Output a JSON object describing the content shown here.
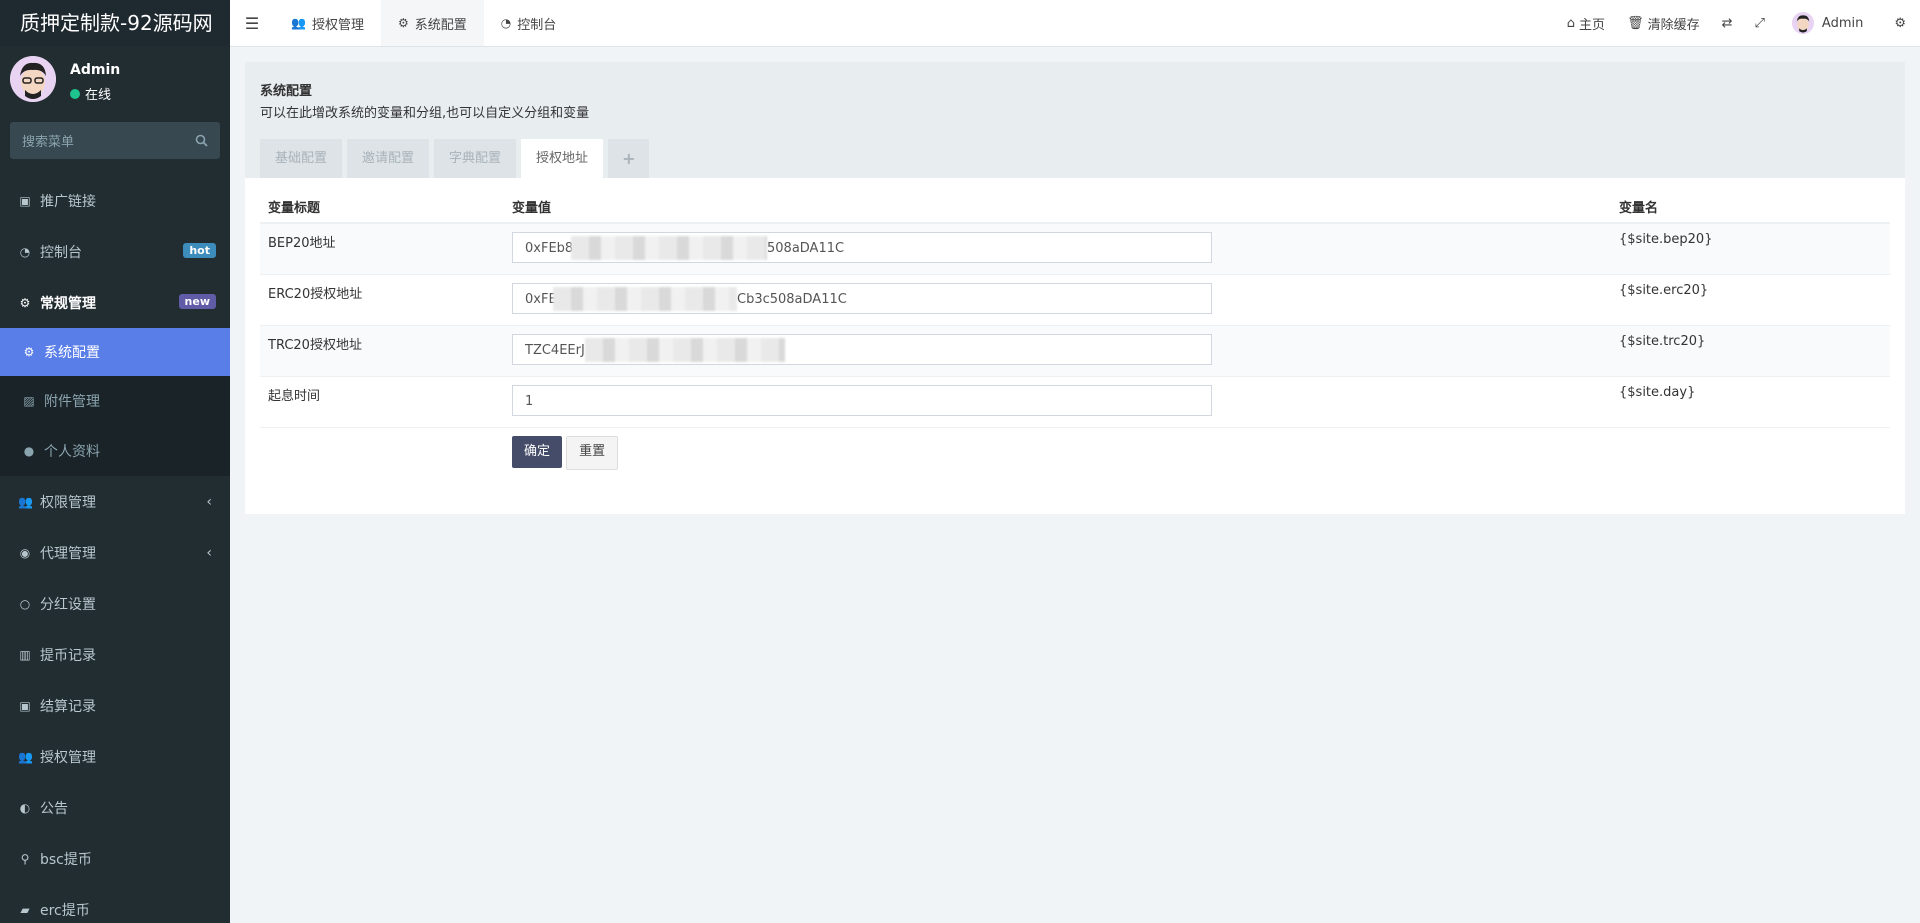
{
  "brand": "质押定制款-92源码网",
  "user": {
    "name": "Admin",
    "status": "在线"
  },
  "search": {
    "placeholder": "搜索菜单"
  },
  "colors": {
    "sidebar": "#222d32",
    "active": "#5a7ee8",
    "hot": "#3c8dbc",
    "new": "#605ca8",
    "online": "#1ec38d",
    "primary_btn": "#444c69"
  },
  "sidebar": {
    "items": [
      {
        "label": "推广链接",
        "icon": "link-card-icon"
      },
      {
        "label": "控制台",
        "icon": "dashboard-icon",
        "badge": "hot"
      },
      {
        "label": "常规管理",
        "icon": "cogs-icon",
        "badge": "new"
      },
      {
        "label": "系统配置",
        "icon": "gear-icon"
      },
      {
        "label": "附件管理",
        "icon": "image-icon"
      },
      {
        "label": "个人资料",
        "icon": "user-icon"
      },
      {
        "label": "权限管理",
        "icon": "group-icon"
      },
      {
        "label": "代理管理",
        "icon": "user-circle-icon"
      },
      {
        "label": "分红设置",
        "icon": "circle-icon"
      },
      {
        "label": "提币记录",
        "icon": "bank-icon"
      },
      {
        "label": "结算记录",
        "icon": "card-icon"
      },
      {
        "label": "授权管理",
        "icon": "group-icon"
      },
      {
        "label": "公告",
        "icon": "half-circle-icon"
      },
      {
        "label": "bsc提币",
        "icon": "bicycle-icon"
      },
      {
        "label": "erc提币",
        "icon": "briefcase-icon"
      }
    ]
  },
  "topbar": {
    "tabs": [
      "授权管理",
      "系统配置",
      "控制台"
    ],
    "home": "主页",
    "clear_cache": "清除缓存",
    "admin": "Admin"
  },
  "panel": {
    "title": "系统配置",
    "desc": "可以在此增改系统的变量和分组,也可以自定义分组和变量",
    "tabs": [
      "基础配置",
      "邀请配置",
      "字典配置",
      "授权地址"
    ],
    "plus": "+"
  },
  "table": {
    "headers": [
      "变量标题",
      "变量值",
      "变量名"
    ],
    "rows": [
      {
        "title": "BEP20地址",
        "value_start": "0xFEb8",
        "value_end": "508aDA11C",
        "name": "{$site.bep20}"
      },
      {
        "title": "ERC20授权地址",
        "value_start": "0xFE",
        "value_end": "Cb3c508aDA11C",
        "name": "{$site.erc20}"
      },
      {
        "title": "TRC20授权地址",
        "value_start": "TZC4EErJ",
        "value_end": "",
        "name": "{$site.trc20}"
      },
      {
        "title": "起息时间",
        "value_start": "1",
        "value_end": "",
        "name": "{$site.day}"
      }
    ],
    "confirm": "确定",
    "reset": "重置"
  }
}
